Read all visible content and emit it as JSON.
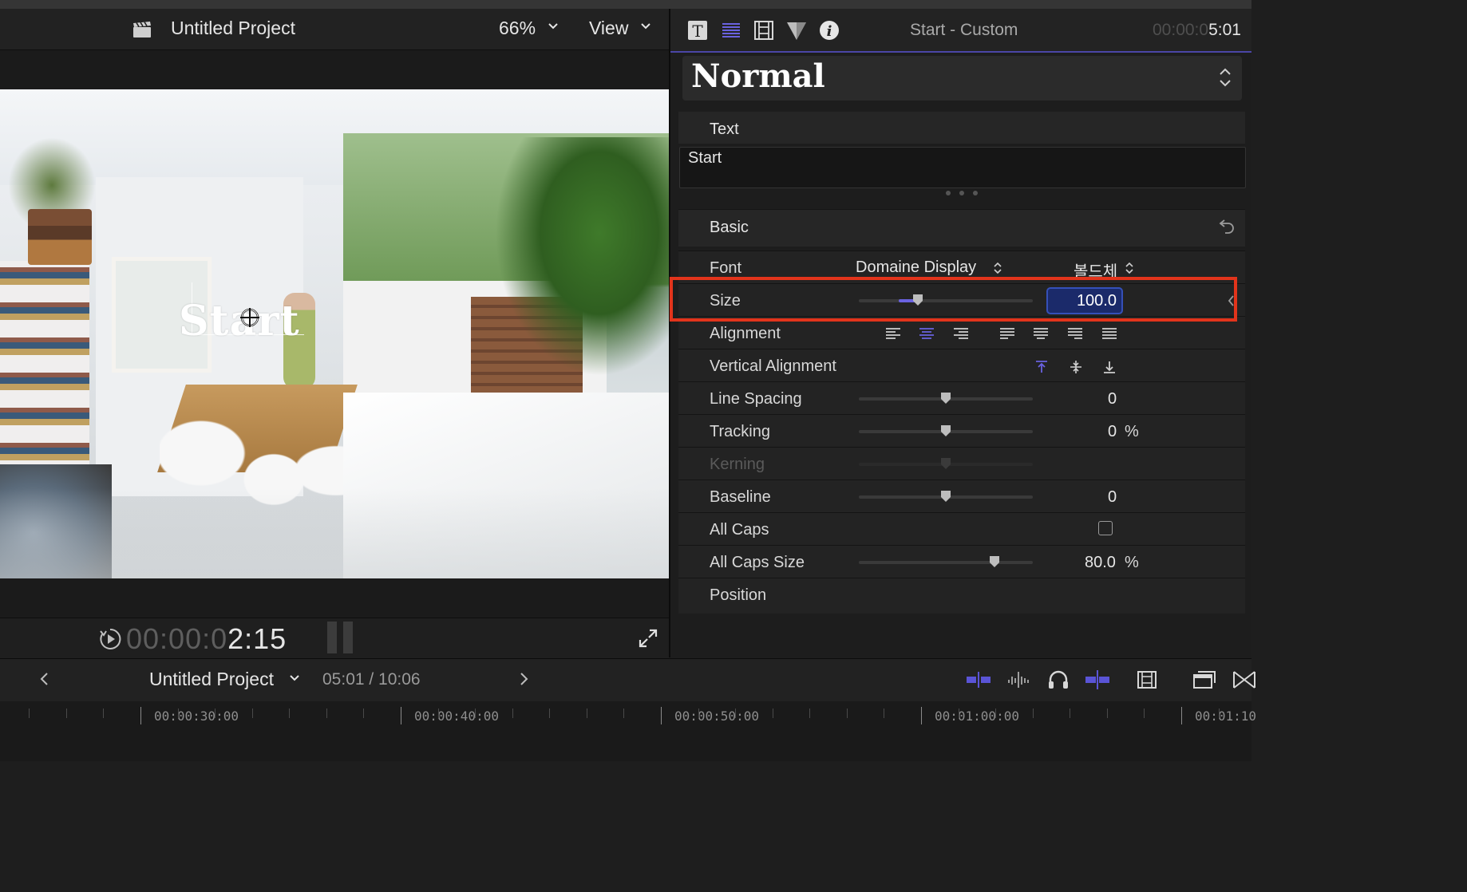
{
  "viewer": {
    "project_title": "Untitled Project",
    "zoom": "66%",
    "view_label": "View",
    "overlay_text": "Start",
    "timecode_dim": "00:00:0",
    "timecode_lit": "2:15"
  },
  "inspector": {
    "title": "Start - Custom",
    "time_dim": "00:00:0",
    "time_lit": "5:01",
    "preset": "Normal",
    "text_section": "Text",
    "text_value": "Start",
    "basic_section": "Basic",
    "rows": {
      "font": {
        "label": "Font",
        "value": "Domaine Display",
        "style": "볼드체"
      },
      "size": {
        "label": "Size",
        "value": "100.0",
        "slider": 0.34
      },
      "alignment": {
        "label": "Alignment"
      },
      "vertical_alignment": {
        "label": "Vertical Alignment"
      },
      "line_spacing": {
        "label": "Line Spacing",
        "value": "0",
        "slider": 0.5
      },
      "tracking": {
        "label": "Tracking",
        "value": "0",
        "unit": "%",
        "slider": 0.5
      },
      "kerning": {
        "label": "Kerning",
        "slider": 0.5
      },
      "baseline": {
        "label": "Baseline",
        "value": "0",
        "slider": 0.5
      },
      "all_caps": {
        "label": "All Caps",
        "checked": false
      },
      "all_caps_size": {
        "label": "All Caps Size",
        "value": "80.0",
        "unit": "%",
        "slider": 0.78
      },
      "position": {
        "label": "Position"
      }
    }
  },
  "timeline": {
    "project_title": "Untitled Project",
    "duration": "05:01 / 10:06",
    "ruler_labels": [
      "00:00:30:00",
      "00:00:40:00",
      "00:00:50:00",
      "00:01:00:00",
      "00:01:10"
    ]
  },
  "icons": {
    "viewer": [
      "clapperboard-icon",
      "chevron-down-icon",
      "play-icon",
      "audio-meter-icon",
      "fullscreen-icon"
    ],
    "inspector_tabs": [
      "text-inspector-icon",
      "text-lines-icon",
      "video-inspector-icon",
      "filter-icon",
      "info-icon"
    ],
    "timeline": [
      "snapping-icon",
      "audio-skimming-icon",
      "solo-icon",
      "skimming-icon",
      "clip-appearance-icon",
      "window-icon",
      "transition-icon"
    ]
  },
  "colors": {
    "accent": "#6a62e0",
    "highlight": "#e2341b",
    "field_focus": "#3550b8"
  }
}
